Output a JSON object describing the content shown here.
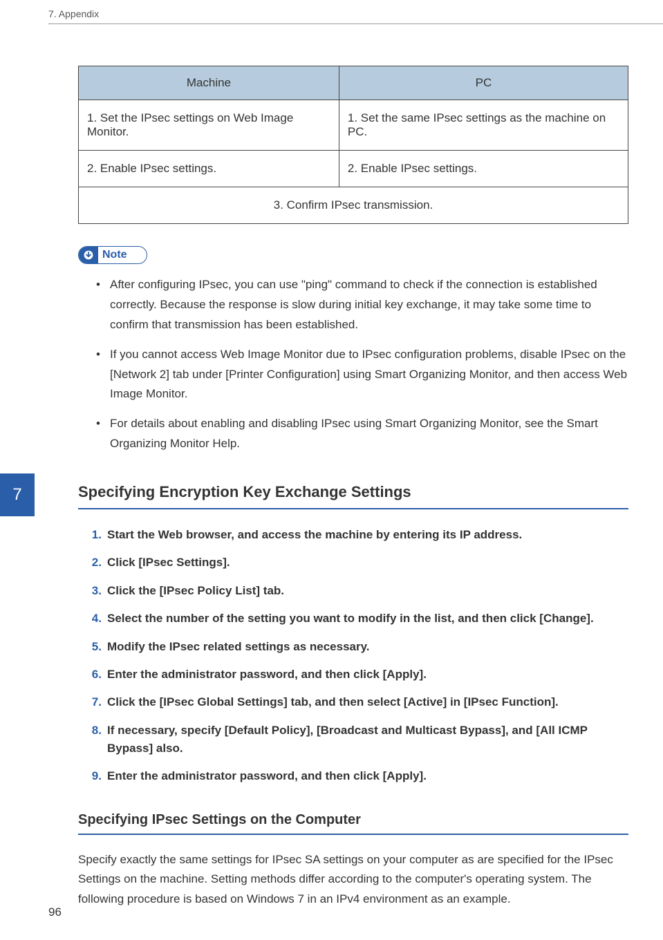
{
  "header": {
    "breadcrumb": "7. Appendix"
  },
  "table": {
    "headers": {
      "col1": "Machine",
      "col2": "PC"
    },
    "rows": [
      {
        "c1": "1. Set the IPsec settings on Web Image Monitor.",
        "c2": "1. Set the same IPsec settings as the machine on PC."
      },
      {
        "c1": "2. Enable IPsec settings.",
        "c2": "2. Enable IPsec settings."
      }
    ],
    "merged_row": "3. Confirm IPsec transmission."
  },
  "note": {
    "label": "Note",
    "items": [
      "After configuring IPsec, you can use \"ping\" command to check if the connection is established correctly. Because the response is slow during initial key exchange, it may take some time to confirm that transmission has been established.",
      "If you cannot access Web Image Monitor due to IPsec configuration problems, disable IPsec on the [Network 2] tab under [Printer Configuration] using Smart Organizing Monitor, and then access Web Image Monitor.",
      "For details about enabling and disabling IPsec using Smart Organizing Monitor, see the Smart Organizing Monitor Help."
    ]
  },
  "chapter_tab": "7",
  "section1": {
    "title": "Specifying Encryption Key Exchange Settings",
    "steps": [
      "Start the Web browser, and access the machine by entering its IP address.",
      "Click [IPsec Settings].",
      "Click the [IPsec Policy List] tab.",
      "Select the number of the setting you want to modify in the list, and then click [Change].",
      "Modify the IPsec related settings as necessary.",
      "Enter the administrator password, and then click [Apply].",
      "Click the [IPsec Global Settings] tab, and then select [Active] in [IPsec Function].",
      "If necessary, specify [Default Policy], [Broadcast and Multicast Bypass], and [All ICMP Bypass] also.",
      "Enter the administrator password, and then click [Apply]."
    ]
  },
  "section2": {
    "title": "Specifying IPsec Settings on the Computer",
    "paragraph": "Specify exactly the same settings for IPsec SA settings on your computer as are specified for the IPsec Settings on the machine. Setting methods differ according to the computer's operating system. The following procedure is based on Windows 7 in an IPv4 environment as an example."
  },
  "page_number": "96"
}
